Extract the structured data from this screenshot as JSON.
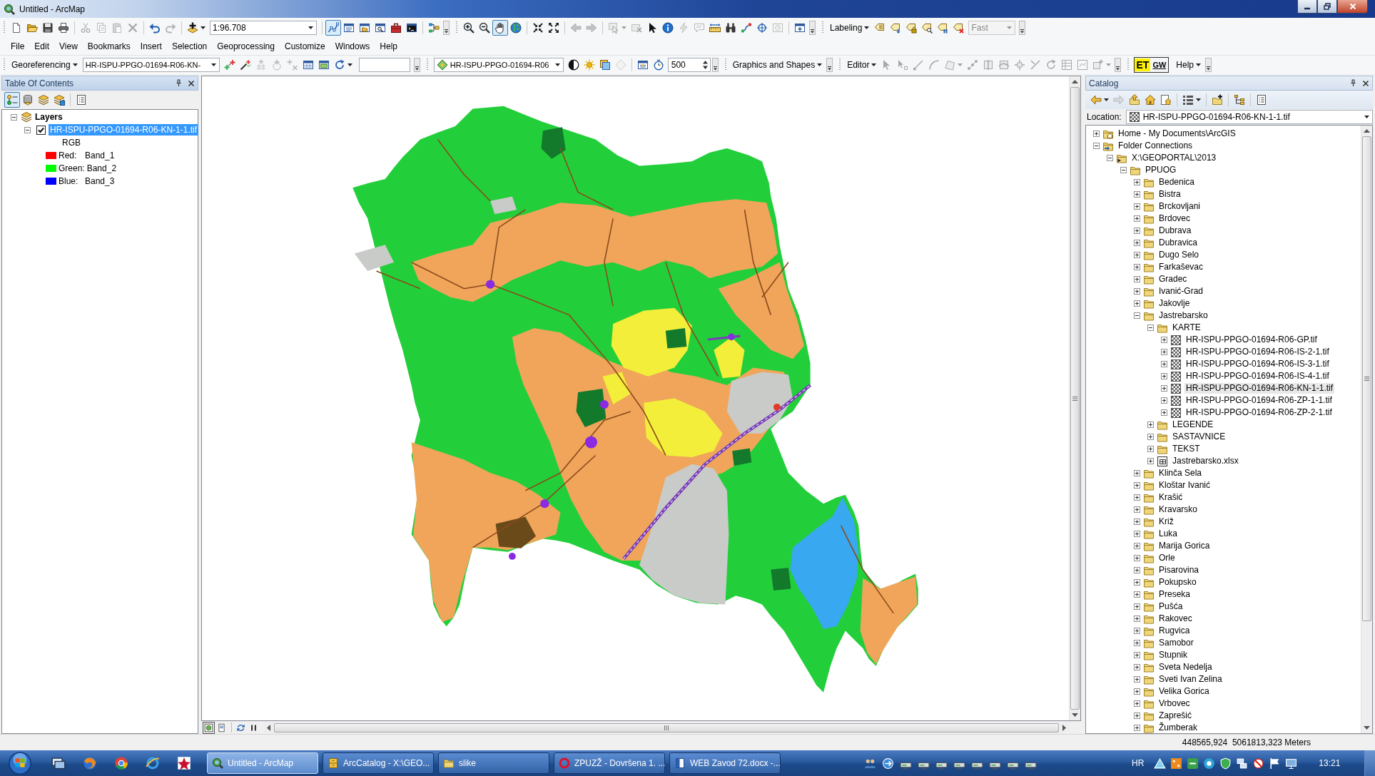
{
  "window": {
    "title": "Untitled - ArcMap"
  },
  "toolbar_row_1": {
    "standard": {
      "buttons": [
        {
          "disabled": false,
          "pressed": false
        },
        {
          "disabled": false,
          "pressed": false
        },
        {
          "disabled": false,
          "pressed": false
        },
        {
          "disabled": false,
          "pressed": false
        },
        {
          "disabled": true,
          "pressed": false
        },
        {
          "disabled": true,
          "pressed": false
        },
        {
          "disabled": true,
          "pressed": false
        },
        {
          "disabled": true,
          "pressed": false
        },
        {
          "disabled": false,
          "pressed": false
        },
        {
          "disabled": true,
          "pressed": false
        },
        {
          "disabled": false,
          "pressed": false
        },
        {
          "disabled": false,
          "pressed": true
        },
        {
          "disabled": false,
          "pressed": false
        },
        {
          "disabled": false,
          "pressed": false
        },
        {
          "disabled": false,
          "pressed": false
        },
        {
          "disabled": false,
          "pressed": false
        },
        {
          "disabled": false,
          "pressed": false
        },
        {
          "disabled": false,
          "pressed": false
        }
      ],
      "scale": "1:96.708"
    },
    "tools": {
      "buttons": [
        {
          "disabled": false,
          "pressed": false
        },
        {
          "disabled": false,
          "pressed": false
        },
        {
          "disabled": false,
          "pressed": true
        },
        {
          "disabled": false,
          "pressed": false
        },
        {
          "disabled": false,
          "pressed": false
        },
        {
          "disabled": false,
          "pressed": false
        },
        {
          "disabled": true,
          "pressed": false
        },
        {
          "disabled": true,
          "pressed": false
        },
        {
          "disabled": true,
          "pressed": false
        },
        {
          "disabled": true,
          "pressed": false
        },
        {
          "disabled": false,
          "pressed": false
        },
        {
          "disabled": false,
          "pressed": false
        },
        {
          "disabled": true,
          "pressed": false
        },
        {
          "disabled": true,
          "pressed": false
        },
        {
          "disabled": false,
          "pressed": false
        },
        {
          "disabled": false,
          "pressed": false
        },
        {
          "disabled": false,
          "pressed": false
        },
        {
          "disabled": false,
          "pressed": false
        },
        {
          "disabled": true,
          "pressed": false
        },
        {
          "disabled": false,
          "pressed": false
        }
      ]
    },
    "labeling": {
      "menu": "Labeling",
      "buttons": [
        {
          "disabled": false,
          "pressed": false
        },
        {
          "disabled": false,
          "pressed": false
        },
        {
          "disabled": false,
          "pressed": false
        },
        {
          "disabled": false,
          "pressed": false
        },
        {
          "disabled": false,
          "pressed": false
        },
        {
          "disabled": false,
          "pressed": false
        }
      ],
      "quality": {
        "value": "Fast",
        "disabled": true
      }
    }
  },
  "menu_bar": [
    "File",
    "Edit",
    "View",
    "Bookmarks",
    "Insert",
    "Selection",
    "Geoprocessing",
    "Customize",
    "Windows",
    "Help"
  ],
  "toolbar_row_2": {
    "georeferencing": {
      "menu": "Georeferencing",
      "layer": "HR-ISPU-PPGO-01694-R06-KN-",
      "buttons": [
        {
          "disabled": false,
          "pressed": false
        },
        {
          "disabled": false,
          "pressed": false
        },
        {
          "disabled": true,
          "pressed": false
        },
        {
          "disabled": true,
          "pressed": false
        },
        {
          "disabled": true,
          "pressed": false
        },
        {
          "disabled": false,
          "pressed": false
        },
        {
          "disabled": false,
          "pressed": false
        },
        {
          "disabled": false,
          "pressed": false
        }
      ]
    },
    "effects": {
      "layer": "HR-ISPU-PPGO-01694-R06",
      "buttons": [
        {
          "disabled": false,
          "pressed": false
        },
        {
          "disabled": false,
          "pressed": false
        },
        {
          "disabled": false,
          "pressed": false
        },
        {
          "disabled": true,
          "pressed": false
        },
        {
          "disabled": false,
          "pressed": false
        },
        {
          "disabled": false,
          "pressed": false
        }
      ],
      "rate": "500"
    },
    "draw": {
      "menu": "Graphics and Shapes"
    },
    "editor": {
      "menu": "Editor",
      "buttons": [
        {
          "disabled": true,
          "pressed": false
        },
        {
          "disabled": true,
          "pressed": false
        },
        {
          "disabled": true,
          "pressed": false
        },
        {
          "disabled": true,
          "pressed": false
        },
        {
          "disabled": true,
          "pressed": false
        },
        {
          "disabled": true,
          "pressed": false
        },
        {
          "disabled": true,
          "pressed": false
        },
        {
          "disabled": true,
          "pressed": false
        },
        {
          "disabled": true,
          "pressed": false
        },
        {
          "disabled": true,
          "pressed": false
        },
        {
          "disabled": true,
          "pressed": false
        },
        {
          "disabled": true,
          "pressed": false
        },
        {
          "disabled": true,
          "pressed": false
        },
        {
          "disabled": true,
          "pressed": false
        }
      ]
    },
    "custom": {
      "logo_left": "ET",
      "logo_right": "GW",
      "menu": "Help"
    }
  },
  "table_of_contents": {
    "title": "Table Of Contents",
    "buttons": [
      {
        "disabled": false,
        "pressed": true
      },
      {
        "disabled": false,
        "pressed": false
      },
      {
        "disabled": false,
        "pressed": false
      },
      {
        "disabled": false,
        "pressed": false
      },
      {
        "disabled": false,
        "pressed": false
      }
    ],
    "tree": [
      {
        "label": "Layers",
        "expanded": true,
        "children": [
          {
            "label": "HR-ISPU-PPGO-01694-R06-KN-1-1.tif",
            "checked": true,
            "selected": true,
            "expanded": true,
            "legend": {
              "heading": "RGB",
              "bands": [
                {
                  "channel": "Red:",
                  "band": "Band_1",
                  "color": "#ff0000"
                },
                {
                  "channel": "Green:",
                  "band": "Band_2",
                  "color": "#00ff00"
                },
                {
                  "channel": "Blue:",
                  "band": "Band_3",
                  "color": "#0000ff"
                }
              ]
            }
          }
        ]
      }
    ]
  },
  "map_view": {
    "view_buttons": [
      {
        "selected": true
      },
      {
        "selected": false
      }
    ]
  },
  "catalog": {
    "title": "Catalog",
    "buttons": [
      {
        "disabled": false,
        "pressed": false
      },
      {
        "disabled": true,
        "pressed": false
      },
      {
        "disabled": false,
        "pressed": false
      },
      {
        "disabled": false,
        "pressed": false
      },
      {
        "disabled": false,
        "pressed": false
      },
      {
        "disabled": false,
        "pressed": false
      },
      {
        "disabled": false,
        "pressed": false
      },
      {
        "disabled": false,
        "pressed": false
      },
      {
        "disabled": false,
        "pressed": false
      }
    ],
    "location_label": "Location:",
    "location": "HR-ISPU-PPGO-01694-R06-KN-1-1.tif",
    "tree": [
      {
        "label": "Home - My Documents\\ArcGIS",
        "kind": "home",
        "expanded": false,
        "selected": false
      },
      {
        "label": "Folder Connections",
        "kind": "connections",
        "expanded": true,
        "selected": false,
        "children": [
          {
            "label": "X:\\GEOPORTAL\\2013",
            "kind": "connection",
            "expanded": true,
            "selected": false,
            "children": [
              {
                "label": "PPUOG",
                "kind": "folder",
                "expanded": true,
                "selected": false,
                "children": [
                  {
                    "label": "Bedenica",
                    "kind": "folder",
                    "expanded": false,
                    "selected": false
                  },
                  {
                    "label": "Bistra",
                    "kind": "folder",
                    "expanded": false,
                    "selected": false
                  },
                  {
                    "label": "Brckovljani",
                    "kind": "folder",
                    "expanded": false,
                    "selected": false
                  },
                  {
                    "label": "Brdovec",
                    "kind": "folder",
                    "expanded": false,
                    "selected": false
                  },
                  {
                    "label": "Dubrava",
                    "kind": "folder",
                    "expanded": false,
                    "selected": false
                  },
                  {
                    "label": "Dubravica",
                    "kind": "folder",
                    "expanded": false,
                    "selected": false
                  },
                  {
                    "label": "Dugo Selo",
                    "kind": "folder",
                    "expanded": false,
                    "selected": false
                  },
                  {
                    "label": "Farkaševac",
                    "kind": "folder",
                    "expanded": false,
                    "selected": false
                  },
                  {
                    "label": "Gradec",
                    "kind": "folder",
                    "expanded": false,
                    "selected": false
                  },
                  {
                    "label": "Ivanić-Grad",
                    "kind": "folder",
                    "expanded": false,
                    "selected": false
                  },
                  {
                    "label": "Jakovlje",
                    "kind": "folder",
                    "expanded": false,
                    "selected": false
                  },
                  {
                    "label": "Jastrebarsko",
                    "kind": "folder",
                    "expanded": true,
                    "selected": false,
                    "children": [
                      {
                        "label": "KARTE",
                        "kind": "folder",
                        "expanded": true,
                        "selected": false,
                        "children": [
                          {
                            "label": "HR-ISPU-PPGO-01694-R06-GP.tif",
                            "kind": "raster",
                            "expanded": false,
                            "selected": false
                          },
                          {
                            "label": "HR-ISPU-PPGO-01694-R06-IS-2-1.tif",
                            "kind": "raster",
                            "expanded": false,
                            "selected": false
                          },
                          {
                            "label": "HR-ISPU-PPGO-01694-R06-IS-3-1.tif",
                            "kind": "raster",
                            "expanded": false,
                            "selected": false
                          },
                          {
                            "label": "HR-ISPU-PPGO-01694-R06-IS-4-1.tif",
                            "kind": "raster",
                            "expanded": false,
                            "selected": false
                          },
                          {
                            "label": "HR-ISPU-PPGO-01694-R06-KN-1-1.tif",
                            "kind": "raster",
                            "expanded": false,
                            "selected": true
                          },
                          {
                            "label": "HR-ISPU-PPGO-01694-R06-ZP-1-1.tif",
                            "kind": "raster",
                            "expanded": false,
                            "selected": false
                          },
                          {
                            "label": "HR-ISPU-PPGO-01694-R06-ZP-2-1.tif",
                            "kind": "raster",
                            "expanded": false,
                            "selected": false
                          }
                        ]
                      },
                      {
                        "label": "LEGENDE",
                        "kind": "folder",
                        "expanded": false,
                        "selected": false
                      },
                      {
                        "label": "SASTAVNICE",
                        "kind": "folder",
                        "expanded": false,
                        "selected": false
                      },
                      {
                        "label": "TEKST",
                        "kind": "folder",
                        "expanded": false,
                        "selected": false
                      },
                      {
                        "label": "Jastrebarsko.xlsx",
                        "kind": "table",
                        "expanded": false,
                        "selected": false
                      }
                    ]
                  },
                  {
                    "label": "Klinča Sela",
                    "kind": "folder",
                    "expanded": false,
                    "selected": false
                  },
                  {
                    "label": "Kloštar Ivanić",
                    "kind": "folder",
                    "expanded": false,
                    "selected": false
                  },
                  {
                    "label": "Krašić",
                    "kind": "folder",
                    "expanded": false,
                    "selected": false
                  },
                  {
                    "label": "Kravarsko",
                    "kind": "folder",
                    "expanded": false,
                    "selected": false
                  },
                  {
                    "label": "Križ",
                    "kind": "folder",
                    "expanded": false,
                    "selected": false
                  },
                  {
                    "label": "Luka",
                    "kind": "folder",
                    "expanded": false,
                    "selected": false
                  },
                  {
                    "label": "Marija Gorica",
                    "kind": "folder",
                    "expanded": false,
                    "selected": false
                  },
                  {
                    "label": "Orle",
                    "kind": "folder",
                    "expanded": false,
                    "selected": false
                  },
                  {
                    "label": "Pisarovina",
                    "kind": "folder",
                    "expanded": false,
                    "selected": false
                  },
                  {
                    "label": "Pokupsko",
                    "kind": "folder",
                    "expanded": false,
                    "selected": false
                  },
                  {
                    "label": "Preseka",
                    "kind": "folder",
                    "expanded": false,
                    "selected": false
                  },
                  {
                    "label": "Pušća",
                    "kind": "folder",
                    "expanded": false,
                    "selected": false
                  },
                  {
                    "label": "Rakovec",
                    "kind": "folder",
                    "expanded": false,
                    "selected": false
                  },
                  {
                    "label": "Rugvica",
                    "kind": "folder",
                    "expanded": false,
                    "selected": false
                  },
                  {
                    "label": "Samobor",
                    "kind": "folder",
                    "expanded": false,
                    "selected": false
                  },
                  {
                    "label": "Stupnik",
                    "kind": "folder",
                    "expanded": false,
                    "selected": false
                  },
                  {
                    "label": "Sveta Nedelja",
                    "kind": "folder",
                    "expanded": false,
                    "selected": false
                  },
                  {
                    "label": "Sveti Ivan Zelina",
                    "kind": "folder",
                    "expanded": false,
                    "selected": false
                  },
                  {
                    "label": "Velika Gorica",
                    "kind": "folder",
                    "expanded": false,
                    "selected": false
                  },
                  {
                    "label": "Vrbovec",
                    "kind": "folder",
                    "expanded": false,
                    "selected": false
                  },
                  {
                    "label": "Zaprešić",
                    "kind": "folder",
                    "expanded": false,
                    "selected": false
                  },
                  {
                    "label": "Žumberak",
                    "kind": "folder",
                    "expanded": false,
                    "selected": false
                  }
                ]
              }
            ]
          }
        ]
      }
    ]
  },
  "status_bar": {
    "coordinates": "448565,924  5061813,323 Meters"
  },
  "taskbar": {
    "tasks": [
      {
        "label": "Untitled - ArcMap",
        "selected": true
      },
      {
        "label": "ArcCatalog - X:\\GEO...",
        "selected": false
      },
      {
        "label": "slike",
        "selected": false
      },
      {
        "label": "ZPUZŽ - Dovršena 1. ...",
        "selected": false
      },
      {
        "label": "WEB Zavod 72.docx -...",
        "selected": false
      }
    ],
    "language": "HR",
    "clock": "13:21"
  }
}
